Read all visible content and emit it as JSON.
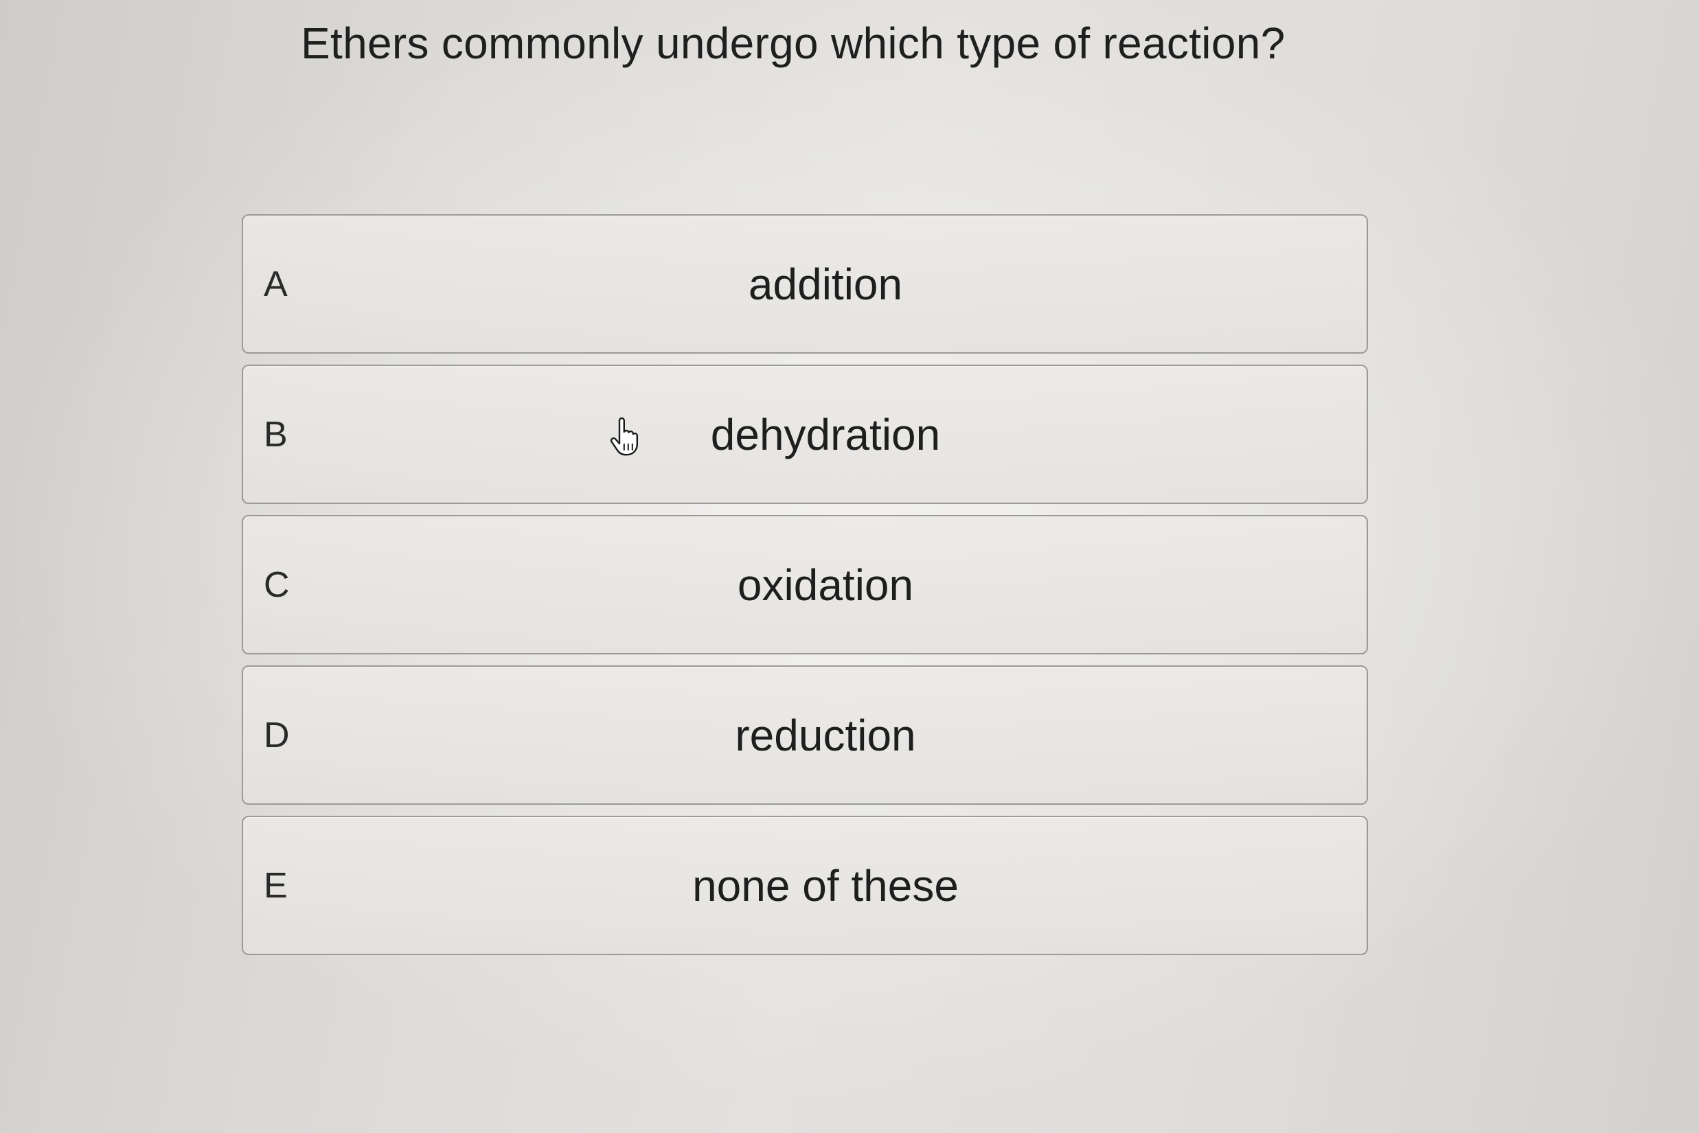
{
  "question": "Ethers commonly undergo which type of reaction?",
  "options": [
    {
      "letter": "A",
      "text": "addition"
    },
    {
      "letter": "B",
      "text": "dehydration"
    },
    {
      "letter": "C",
      "text": "oxidation"
    },
    {
      "letter": "D",
      "text": "reduction"
    },
    {
      "letter": "E",
      "text": "none of these"
    }
  ],
  "cursor": {
    "icon": "hand-pointer-icon"
  }
}
